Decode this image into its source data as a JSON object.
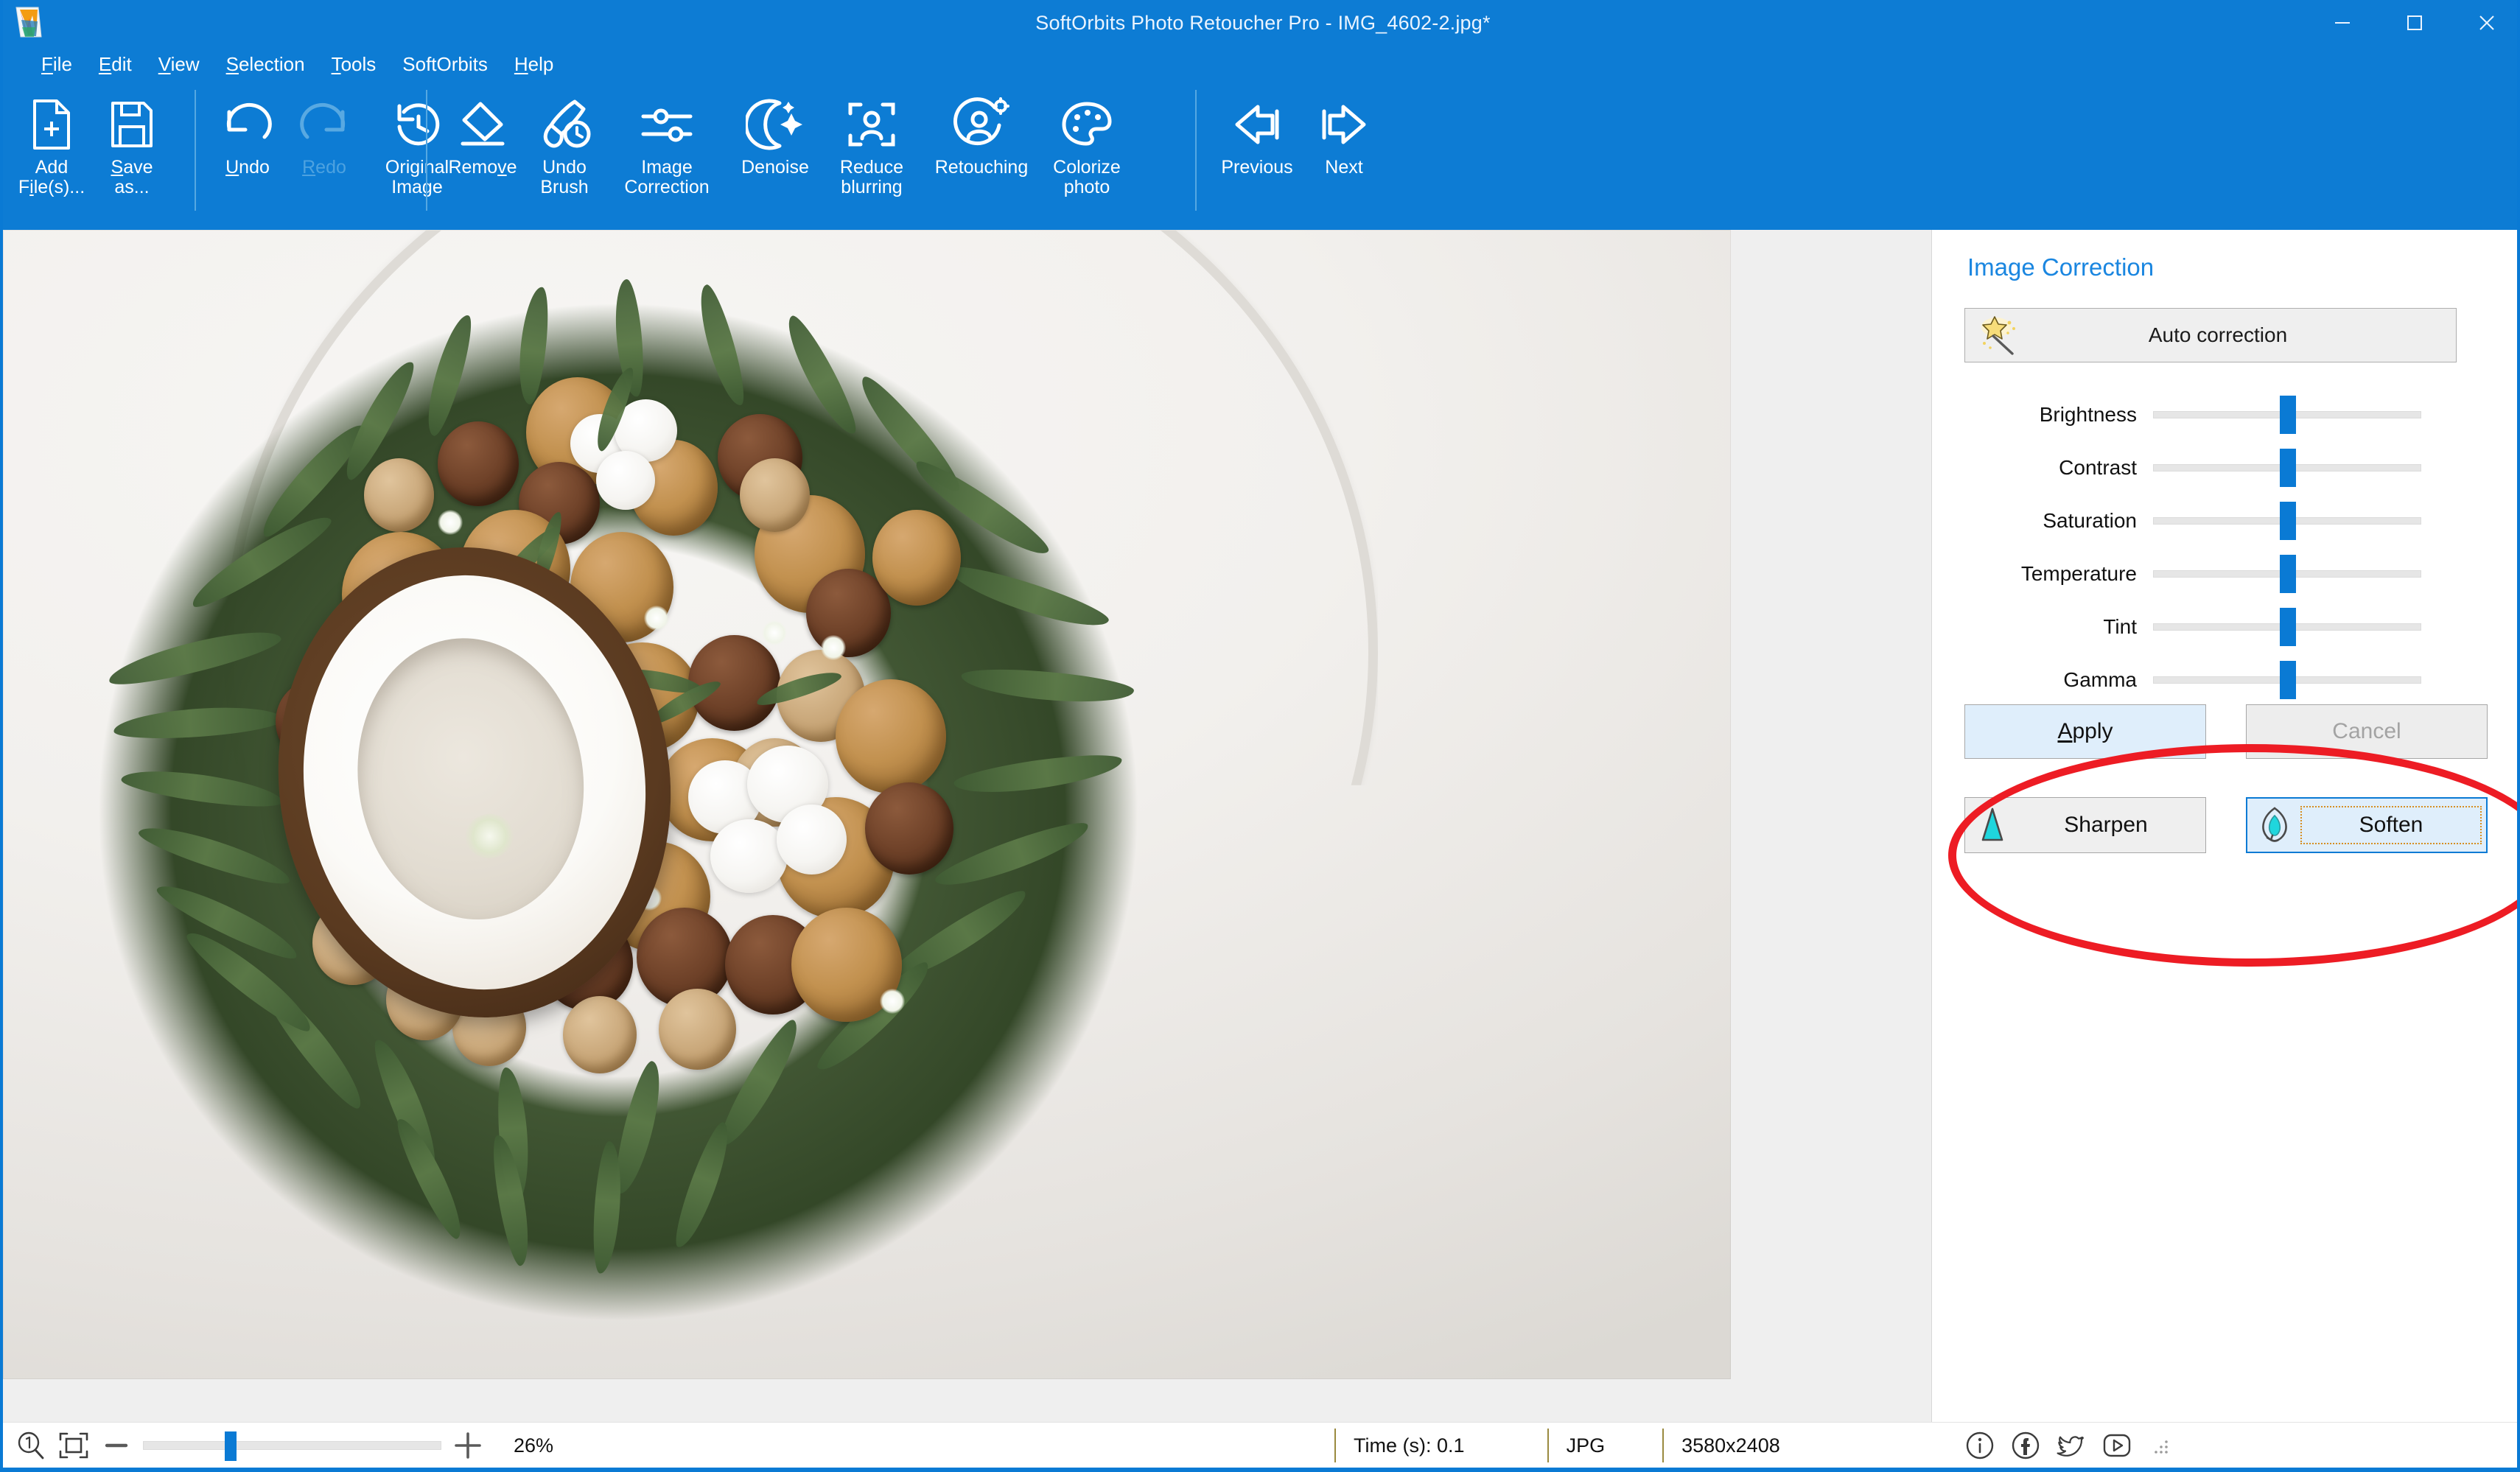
{
  "window": {
    "title": "SoftOrbits Photo Retoucher Pro - IMG_4602-2.jpg*",
    "controls": {
      "minimize": "minimize-button",
      "maximize": "maximize-button",
      "close": "close-button"
    },
    "accent_color": "#0d7cd4"
  },
  "menubar": {
    "items": [
      {
        "label": "File",
        "mnemonic": "F"
      },
      {
        "label": "Edit",
        "mnemonic": "E"
      },
      {
        "label": "View",
        "mnemonic": "V"
      },
      {
        "label": "Selection",
        "mnemonic": "S"
      },
      {
        "label": "Tools",
        "mnemonic": "T"
      },
      {
        "label": "SoftOrbits",
        "mnemonic": ""
      },
      {
        "label": "Help",
        "mnemonic": "H"
      }
    ]
  },
  "toolbar": {
    "groups": [
      {
        "buttons": [
          {
            "label": "Add\nFile(s)...",
            "icon": "add-file-icon",
            "enabled": true
          },
          {
            "label": "Save\nas...",
            "icon": "save-as-icon",
            "enabled": true
          }
        ]
      },
      {
        "buttons": [
          {
            "label": "Undo",
            "icon": "undo-arrow-icon",
            "enabled": true
          },
          {
            "label": "Redo",
            "icon": "redo-arrow-icon",
            "enabled": false
          },
          {
            "label": "Original\nImage",
            "icon": "history-clock-icon",
            "enabled": true
          }
        ]
      },
      {
        "buttons": [
          {
            "label": "Remove",
            "icon": "eraser-icon",
            "enabled": true
          },
          {
            "label": "Undo\nBrush",
            "icon": "brush-clock-icon",
            "enabled": true
          },
          {
            "label": "Image\nCorrection",
            "icon": "sliders-icon",
            "enabled": true
          },
          {
            "label": "Denoise",
            "icon": "moon-stars-icon",
            "enabled": true
          },
          {
            "label": "Reduce\nblurring",
            "icon": "portrait-frame-icon",
            "enabled": true
          },
          {
            "label": "Retouching",
            "icon": "person-gear-icon",
            "enabled": true
          },
          {
            "label": "Colorize\nphoto",
            "icon": "palette-icon",
            "enabled": true
          }
        ]
      },
      {
        "buttons": [
          {
            "label": "Previous",
            "icon": "arrow-left-icon",
            "enabled": true
          },
          {
            "label": "Next",
            "icon": "arrow-right-icon",
            "enabled": true
          }
        ]
      }
    ]
  },
  "panel": {
    "title": "Image Correction",
    "auto_correction": {
      "label": "Auto correction",
      "icon": "magic-wand-icon"
    },
    "sliders": [
      {
        "label": "Brightness",
        "value": 50,
        "min": 0,
        "max": 100
      },
      {
        "label": "Contrast",
        "value": 50,
        "min": 0,
        "max": 100
      },
      {
        "label": "Saturation",
        "value": 50,
        "min": 0,
        "max": 100
      },
      {
        "label": "Temperature",
        "value": 50,
        "min": 0,
        "max": 100
      },
      {
        "label": "Tint",
        "value": 50,
        "min": 0,
        "max": 100
      },
      {
        "label": "Gamma",
        "value": 50,
        "min": 0,
        "max": 100
      }
    ],
    "apply_label": "Apply",
    "apply_mnemonic": "A",
    "cancel_label": "Cancel",
    "cancel_enabled": false,
    "sharpen_label": "Sharpen",
    "sharpen_icon": "sharpen-triangle-icon",
    "soften_label": "Soften",
    "soften_icon": "soften-droplet-icon",
    "soften_focused": true,
    "annotation": {
      "shape": "ellipse",
      "color": "#ed1c24",
      "surrounds": "sharpen-and-soften-buttons"
    }
  },
  "statusbar": {
    "zoom_actual_icon": "zoom-actual-size-icon",
    "zoom_fit_icon": "zoom-fit-icon",
    "zoom_out_icon": "zoom-out-icon",
    "zoom_in_icon": "zoom-in-icon",
    "zoom_percent": "26%",
    "zoom_slider_value": 26,
    "time": "Time (s): 0.1",
    "format": "JPG",
    "dimensions": "3580x2408",
    "socials": [
      {
        "icon": "info-icon"
      },
      {
        "icon": "facebook-icon"
      },
      {
        "icon": "twitter-icon"
      },
      {
        "icon": "youtube-icon"
      }
    ]
  },
  "canvas": {
    "photo_alt": "Nut bouquet with halved coconut, walnuts, macadamia nuts, cotton bolls and green foliage on white background"
  }
}
